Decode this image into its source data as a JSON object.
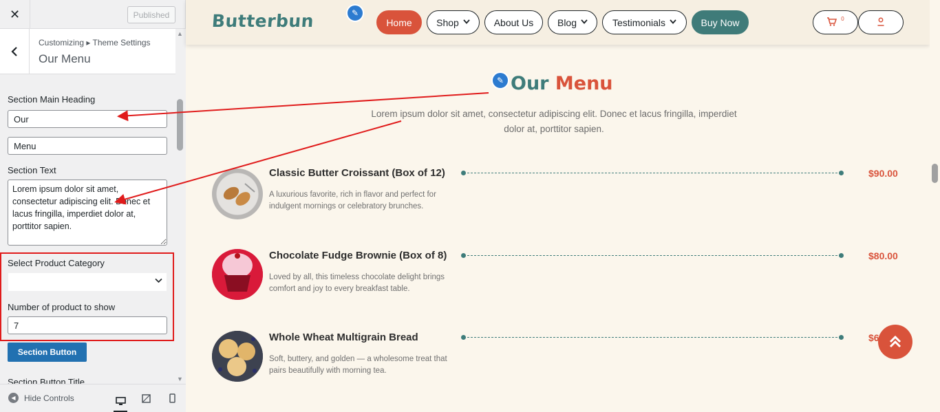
{
  "customizer": {
    "close_icon": "close-icon",
    "published_label": "Published",
    "breadcrumb": "Customizing ▸ Theme Settings",
    "section_title": "Our Menu",
    "fields": {
      "main_heading_label": "Section Main Heading",
      "main_heading_part1": "Our",
      "main_heading_part2": "Menu",
      "section_text_label": "Section Text",
      "section_text_value": "Lorem ipsum dolor sit amet, consectetur adipiscing elit. Donec et lacus fringilla, imperdiet dolor at, porttitor sapien.",
      "category_label": "Select Product Category",
      "category_value": "",
      "count_label": "Number of product to show",
      "count_value": "7",
      "section_button_label": "Section Button",
      "button_title_label": "Section Button Title"
    },
    "footer": {
      "hide_controls_label": "Hide Controls",
      "devices": [
        "desktop-icon",
        "tablet-icon",
        "mobile-icon"
      ]
    }
  },
  "site": {
    "logo": "Butterbun",
    "nav": [
      {
        "label": "Home",
        "has_dropdown": false,
        "active": true
      },
      {
        "label": "Shop",
        "has_dropdown": true
      },
      {
        "label": "About Us",
        "has_dropdown": false
      },
      {
        "label": "Blog",
        "has_dropdown": true
      },
      {
        "label": "Testimonials",
        "has_dropdown": true
      },
      {
        "label": "Buy Now",
        "has_dropdown": false
      }
    ],
    "cart_count": "0",
    "colors": {
      "accent": "#d9533b",
      "teal": "#3e7c7a",
      "bg": "#fbf6ec"
    }
  },
  "menu_section": {
    "heading_part1": "Our",
    "heading_part2": "Menu",
    "text": "Lorem ipsum dolor sit amet, consectetur adipiscing elit. Donec et lacus fringilla, imperdiet dolor at, porttitor sapien.",
    "items": [
      {
        "title": "Classic Butter Croissant (Box of 12)",
        "desc": "A luxurious favorite, rich in flavor and perfect for indulgent mornings or celebratory brunches.",
        "price": "$90.00"
      },
      {
        "title": "Chocolate Fudge Brownie (Box of 8)",
        "desc": "Loved by all, this timeless chocolate delight brings comfort and joy to every breakfast table.",
        "price": "$80.00"
      },
      {
        "title": "Whole Wheat Multigrain Bread",
        "desc": "Soft, buttery, and golden — a wholesome treat that pairs beautifully with morning tea.",
        "price": "$6"
      }
    ]
  }
}
